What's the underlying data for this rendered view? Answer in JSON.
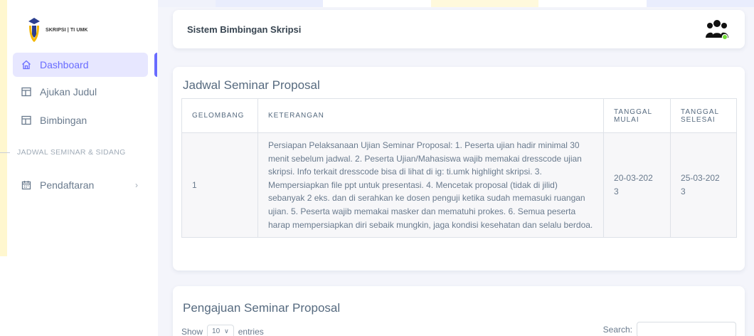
{
  "brand": {
    "logo_text": "SKRIPSI | TI UMK"
  },
  "sidebar": {
    "items": [
      {
        "label": "Dashboard",
        "icon": "home-icon"
      },
      {
        "label": "Ajukan Judul",
        "icon": "layout-icon"
      },
      {
        "label": "Bimbingan",
        "icon": "layout-icon"
      }
    ],
    "section_label": "JADWAL SEMINAR & SIDANG",
    "section_items": [
      {
        "label": "Pendaftaran",
        "icon": "calendar-icon"
      }
    ]
  },
  "navbar": {
    "title": "Sistem Bimbingan Skripsi",
    "user_icon": "users-icon"
  },
  "schedule": {
    "title": "Jadwal Seminar Proposal",
    "columns": [
      "GELOMBANG",
      "KETERANGAN",
      "TANGGAL MULAI",
      "TANGGAL SELESAI"
    ],
    "rows": [
      {
        "gelombang": "1",
        "keterangan": "Persiapan Pelaksanaan Ujian Seminar Proposal: 1. Peserta ujian hadir minimal 30 menit sebelum jadwal. 2. Peserta Ujian/Mahasiswa wajib memakai dresscode ujian skripsi. Info terkait dresscode bisa di lihat di ig: ti.umk highlight skripsi. 3. Mempersiapkan file ppt untuk presentasi. 4. Mencetak proposal (tidak di jilid) sebanyak 2 eks. dan di serahkan ke dosen penguji ketika sudah memasuki ruangan ujian. 5. Peserta wajib memakai masker dan mematuhi prokes. 6. Semua peserta harap mempersiapkan diri sebaik mungkin, jaga kondisi kesehatan dan selalu berdoa.",
        "tanggal_mulai": "20-03-2023",
        "tanggal_selesai": "25-03-2023"
      }
    ]
  },
  "submission": {
    "title": "Pengajuan Seminar Proposal",
    "show_label": "Show",
    "entries_value": "10",
    "entries_label": "entries",
    "search_label": "Search:",
    "search_value": ""
  },
  "colors": {
    "accent": "#696cff",
    "active_bg": "#e7e7ff",
    "status_online": "#71dd37"
  }
}
